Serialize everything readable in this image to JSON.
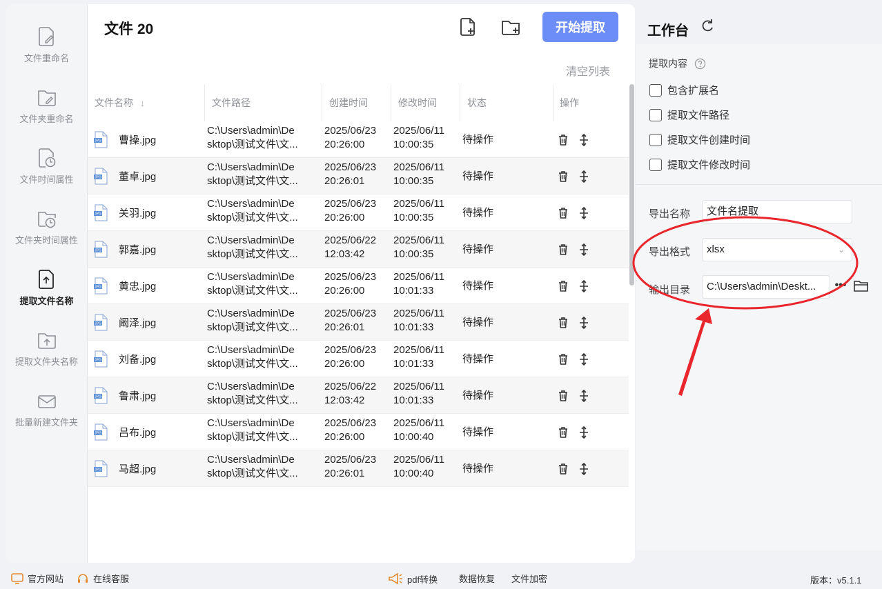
{
  "sidebar": {
    "items": [
      {
        "label": "文件重命名"
      },
      {
        "label": "文件夹重命名"
      },
      {
        "label": "文件时间属性"
      },
      {
        "label": "文件夹时间属性"
      },
      {
        "label": "提取文件名称"
      },
      {
        "label": "提取文件夹名称"
      },
      {
        "label": "批量新建文件夹"
      }
    ]
  },
  "main": {
    "title": "文件 20",
    "start_label": "开始提取",
    "clear_label": "清空列表",
    "columns": [
      "文件名称",
      "文件路径",
      "创建时间",
      "修改时间",
      "状态",
      "操作"
    ],
    "sort_icon": "↓",
    "rows": [
      {
        "name": "曹操.jpg",
        "path1": "C:\\Users\\admin\\De",
        "path2": "sktop\\测试文件\\文...",
        "created1": "2025/06/23",
        "created2": "20:26:00",
        "modified1": "2025/06/11",
        "modified2": "10:00:35",
        "status": "待操作"
      },
      {
        "name": "董卓.jpg",
        "path1": "C:\\Users\\admin\\De",
        "path2": "sktop\\测试文件\\文...",
        "created1": "2025/06/23",
        "created2": "20:26:01",
        "modified1": "2025/06/11",
        "modified2": "10:00:35",
        "status": "待操作"
      },
      {
        "name": "关羽.jpg",
        "path1": "C:\\Users\\admin\\De",
        "path2": "sktop\\测试文件\\文...",
        "created1": "2025/06/23",
        "created2": "20:26:00",
        "modified1": "2025/06/11",
        "modified2": "10:00:35",
        "status": "待操作"
      },
      {
        "name": "郭嘉.jpg",
        "path1": "C:\\Users\\admin\\De",
        "path2": "sktop\\测试文件\\文...",
        "created1": "2025/06/22",
        "created2": "12:03:42",
        "modified1": "2025/06/11",
        "modified2": "10:00:35",
        "status": "待操作"
      },
      {
        "name": "黄忠.jpg",
        "path1": "C:\\Users\\admin\\De",
        "path2": "sktop\\测试文件\\文...",
        "created1": "2025/06/23",
        "created2": "20:26:00",
        "modified1": "2025/06/11",
        "modified2": "10:01:33",
        "status": "待操作"
      },
      {
        "name": "阚泽.jpg",
        "path1": "C:\\Users\\admin\\De",
        "path2": "sktop\\测试文件\\文...",
        "created1": "2025/06/23",
        "created2": "20:26:01",
        "modified1": "2025/06/11",
        "modified2": "10:01:33",
        "status": "待操作"
      },
      {
        "name": "刘备.jpg",
        "path1": "C:\\Users\\admin\\De",
        "path2": "sktop\\测试文件\\文...",
        "created1": "2025/06/23",
        "created2": "20:26:00",
        "modified1": "2025/06/11",
        "modified2": "10:01:33",
        "status": "待操作"
      },
      {
        "name": "鲁肃.jpg",
        "path1": "C:\\Users\\admin\\De",
        "path2": "sktop\\测试文件\\文...",
        "created1": "2025/06/22",
        "created2": "12:03:42",
        "modified1": "2025/06/11",
        "modified2": "10:01:33",
        "status": "待操作"
      },
      {
        "name": "吕布.jpg",
        "path1": "C:\\Users\\admin\\De",
        "path2": "sktop\\测试文件\\文...",
        "created1": "2025/06/23",
        "created2": "20:26:00",
        "modified1": "2025/06/11",
        "modified2": "10:00:40",
        "status": "待操作"
      },
      {
        "name": "马超.jpg",
        "path1": "C:\\Users\\admin\\De",
        "path2": "sktop\\测试文件\\文...",
        "created1": "2025/06/23",
        "created2": "20:26:01",
        "modified1": "2025/06/11",
        "modified2": "10:00:40",
        "status": "待操作"
      }
    ]
  },
  "workbench": {
    "title": "工作台",
    "extract_label": "提取内容",
    "options": [
      "包含扩展名",
      "提取文件路径",
      "提取文件创建时间",
      "提取文件修改时间"
    ],
    "export_name_label": "导出名称",
    "export_name_value": "文件名提取",
    "export_format_label": "导出格式",
    "export_format_value": "xlsx",
    "output_dir_label": "输出目录",
    "output_dir_value": "C:\\Users\\admin\\Deskt...",
    "more_label": "•••"
  },
  "footer": {
    "website": "官方网站",
    "support": "在线客服",
    "pdf": "pdf转换",
    "recovery": "数据恢复",
    "encrypt": "文件加密",
    "version": "版本：v5.1.1"
  },
  "colors": {
    "accent": "#6c8df5",
    "annotation": "#e8262b"
  }
}
